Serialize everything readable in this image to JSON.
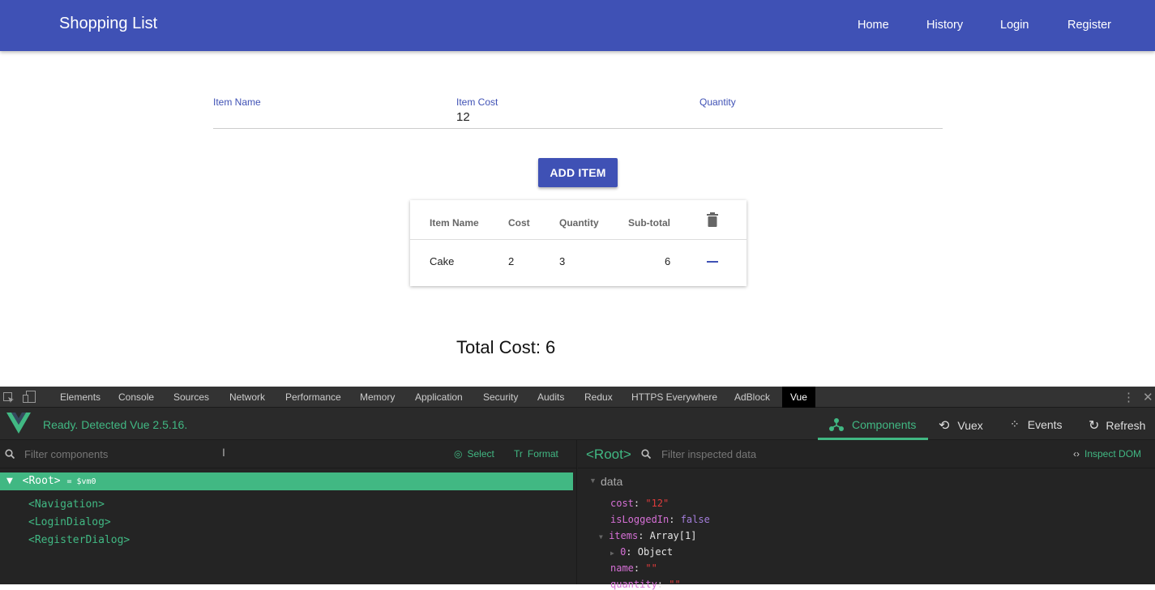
{
  "app": {
    "title": "Shopping List",
    "nav": [
      "Home",
      "History",
      "Login",
      "Register"
    ],
    "form": {
      "item_name_label": "Item Name",
      "item_cost_label": "Item Cost",
      "item_cost_value": "12",
      "quantity_label": "Quantity"
    },
    "add_button": "ADD ITEM",
    "table": {
      "headers": [
        "Item Name",
        "Cost",
        "Quantity",
        "Sub-total"
      ],
      "rows": [
        {
          "name": "Cake",
          "cost": "2",
          "quantity": "3",
          "subtotal": "6"
        }
      ]
    },
    "total": "Total Cost: 6"
  },
  "devtools": {
    "tabs": [
      "Elements",
      "Console",
      "Sources",
      "Network",
      "Performance",
      "Memory",
      "Application",
      "Security",
      "Audits",
      "Redux",
      "HTTPS Everywhere",
      "AdBlock",
      "Vue"
    ],
    "active_tab": "Vue",
    "vue": {
      "status": "Ready. Detected Vue 2.5.16.",
      "tabs": [
        "Components",
        "Vuex",
        "Events",
        "Refresh"
      ],
      "filter_components_placeholder": "Filter components",
      "select_label": "Select",
      "format_label": "Format",
      "tree": {
        "root": "<Root>",
        "root_ref": "= $vm0",
        "children": [
          "<Navigation>",
          "<LoginDialog>",
          "<RegisterDialog>"
        ]
      },
      "inspector": {
        "title": "<Root>",
        "filter_placeholder": "Filter inspected data",
        "inspect_dom": "Inspect DOM",
        "section": "data",
        "props": [
          {
            "key": "cost",
            "value": "\"12\""
          },
          {
            "key": "isLoggedIn",
            "value": "false"
          },
          {
            "key": "items",
            "value": "Array[1]"
          },
          {
            "key": "0",
            "value": "Object"
          },
          {
            "key": "name",
            "value": "\"\""
          },
          {
            "key": "quantity",
            "value": "\"\""
          }
        ]
      }
    },
    "colors": {
      "vue_green": "#41b883",
      "brand_blue": "#3f51b5"
    }
  }
}
